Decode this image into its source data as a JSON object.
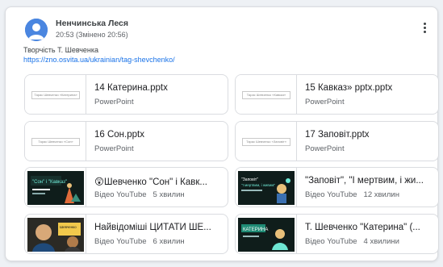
{
  "post": {
    "author": "Ненчинська Леся",
    "time": "20:53 (Змінено 20:56)",
    "description": "Творчість Т. Шевченка",
    "link": "https://zno.osvita.ua/ukrainian/tag-shevchenko/"
  },
  "attachments": [
    {
      "title": "14 Катерина.pptx",
      "type": "PowerPoint",
      "duration": "",
      "thumb_kind": "slide",
      "thumb_text": "Тарас Шевченко «Катерина»"
    },
    {
      "title": "15 Кавказ» pptx.pptx",
      "type": "PowerPoint",
      "duration": "",
      "thumb_kind": "slide",
      "thumb_text": "Тарас Шевченко «Кавказ»"
    },
    {
      "title": "16 Сон.pptx",
      "type": "PowerPoint",
      "duration": "",
      "thumb_kind": "slide",
      "thumb_text": "Тарас Шевченко «Сон»"
    },
    {
      "title": "17 Заповіт.pptx",
      "type": "PowerPoint",
      "duration": "",
      "thumb_kind": "slide",
      "thumb_text": "Тарас Шевченко «Заповіт»"
    },
    {
      "title": "😲Шевченко \"Сон\" і Кавк...",
      "type": "Відео YouTube",
      "duration": "5 хвилин",
      "thumb_kind": "video",
      "thumb_text": "\"Сон\" і \"Кавказ\""
    },
    {
      "title": "\"Заповіт\", \"І мертвим, і жи...",
      "type": "Відео YouTube",
      "duration": "12 хвилин",
      "thumb_kind": "video",
      "thumb_text": "\"Заповіт\" \"І мертвим, і живим\""
    },
    {
      "title": "Найвідоміші ЦИТАТИ ШЕ...",
      "type": "Відео YouTube",
      "duration": "6 хвилин",
      "thumb_kind": "video",
      "thumb_text": "Шевченко"
    },
    {
      "title": "Т. Шевченко \"Катерина\" (...",
      "type": "Відео YouTube",
      "duration": "4 хвилини",
      "thumb_kind": "video",
      "thumb_text": "КАТЕРИНА"
    }
  ],
  "colors": {
    "link": "#1a73e8",
    "avatar": "#4a86e0",
    "video_bg": "#0f1d1b",
    "video_accent": "#6ee7d4"
  }
}
